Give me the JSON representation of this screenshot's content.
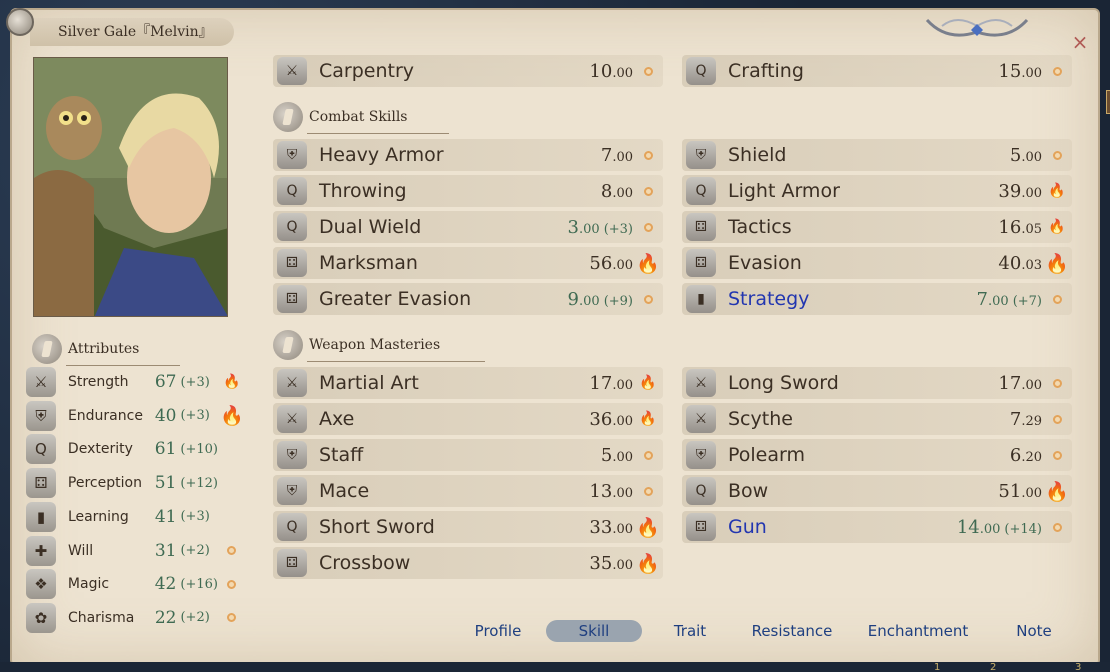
{
  "character": {
    "name": "Silver Gale『Melvin』"
  },
  "window": {
    "close_glyph": "×"
  },
  "attributes": {
    "heading": "Attributes",
    "items": [
      {
        "icon": "crossed-swords-icon",
        "glyph": "⚔",
        "label": "Strength",
        "value": "67",
        "bonus": "(+3)",
        "potential": "flame"
      },
      {
        "icon": "armor-icon",
        "glyph": "⛨",
        "label": "Endurance",
        "value": "40",
        "bonus": "(+3)",
        "potential": "flame-large"
      },
      {
        "icon": "amulet-icon",
        "glyph": "Q",
        "label": "Dexterity",
        "value": "61",
        "bonus": "(+10)",
        "potential": ""
      },
      {
        "icon": "dice-icon",
        "glyph": "⚃",
        "label": "Perception",
        "value": "51",
        "bonus": "(+12)",
        "potential": ""
      },
      {
        "icon": "book-icon",
        "glyph": "▮",
        "label": "Learning",
        "value": "41",
        "bonus": "(+3)",
        "potential": ""
      },
      {
        "icon": "shield-cross-icon",
        "glyph": "✚",
        "label": "Will",
        "value": "31",
        "bonus": "(+2)",
        "potential": "dot"
      },
      {
        "icon": "magic-rune-icon",
        "glyph": "❖",
        "label": "Magic",
        "value": "42",
        "bonus": "(+16)",
        "potential": "dot"
      },
      {
        "icon": "ribbon-icon",
        "glyph": "✿",
        "label": "Charisma",
        "value": "22",
        "bonus": "(+2)",
        "potential": "dot"
      }
    ]
  },
  "skills": {
    "top": [
      {
        "icon": "crossed-swords-icon",
        "glyph": "⚔",
        "label": "Carpentry",
        "value": "10",
        "dec": ".00",
        "bonus": "",
        "potential": "dot",
        "blue": false
      },
      {
        "icon": "amulet-icon",
        "glyph": "Q",
        "label": "Crafting",
        "value": "15",
        "dec": ".00",
        "bonus": "",
        "potential": "dot",
        "blue": false
      }
    ],
    "combat_heading": "Combat Skills",
    "combat": [
      {
        "icon": "armor-icon",
        "glyph": "⛨",
        "label": "Heavy Armor",
        "value": "7",
        "dec": ".00",
        "bonus": "",
        "potential": "dot",
        "blue": false
      },
      {
        "icon": "armor-icon",
        "glyph": "⛨",
        "label": "Shield",
        "value": "5",
        "dec": ".00",
        "bonus": "",
        "potential": "dot",
        "blue": false
      },
      {
        "icon": "amulet-icon",
        "glyph": "Q",
        "label": "Throwing",
        "value": "8",
        "dec": ".00",
        "bonus": "",
        "potential": "dot",
        "blue": false
      },
      {
        "icon": "amulet-icon",
        "glyph": "Q",
        "label": "Light Armor",
        "value": "39",
        "dec": ".00",
        "bonus": "",
        "potential": "flame",
        "blue": false
      },
      {
        "icon": "amulet-icon",
        "glyph": "Q",
        "label": "Dual Wield",
        "value": "3",
        "dec": ".00",
        "bonus": "(+3)",
        "potential": "dot",
        "blue": false
      },
      {
        "icon": "dice-icon",
        "glyph": "⚃",
        "label": "Tactics",
        "value": "16",
        "dec": ".05",
        "bonus": "",
        "potential": "flame",
        "blue": false
      },
      {
        "icon": "dice-icon",
        "glyph": "⚃",
        "label": "Marksman",
        "value": "56",
        "dec": ".00",
        "bonus": "",
        "potential": "flame-plus",
        "blue": false
      },
      {
        "icon": "dice-icon",
        "glyph": "⚃",
        "label": "Evasion",
        "value": "40",
        "dec": ".03",
        "bonus": "",
        "potential": "flame-large",
        "blue": false
      },
      {
        "icon": "dice-icon",
        "glyph": "⚃",
        "label": "Greater Evasion",
        "value": "9",
        "dec": ".00",
        "bonus": "(+9)",
        "potential": "dot",
        "blue": false
      },
      {
        "icon": "book-icon",
        "glyph": "▮",
        "label": "Strategy",
        "value": "7",
        "dec": ".00",
        "bonus": "(+7)",
        "potential": "dot",
        "blue": true
      }
    ],
    "weapon_heading": "Weapon Masteries",
    "weapon": [
      {
        "icon": "crossed-swords-icon",
        "glyph": "⚔",
        "label": "Martial Art",
        "value": "17",
        "dec": ".00",
        "bonus": "",
        "potential": "flame",
        "blue": false
      },
      {
        "icon": "crossed-swords-icon",
        "glyph": "⚔",
        "label": "Long Sword",
        "value": "17",
        "dec": ".00",
        "bonus": "",
        "potential": "dot",
        "blue": false
      },
      {
        "icon": "crossed-swords-icon",
        "glyph": "⚔",
        "label": "Axe",
        "value": "36",
        "dec": ".00",
        "bonus": "",
        "potential": "flame",
        "blue": false
      },
      {
        "icon": "crossed-swords-icon",
        "glyph": "⚔",
        "label": "Scythe",
        "value": "7",
        "dec": ".29",
        "bonus": "",
        "potential": "dot",
        "blue": false
      },
      {
        "icon": "armor-icon",
        "glyph": "⛨",
        "label": "Staff",
        "value": "5",
        "dec": ".00",
        "bonus": "",
        "potential": "dot",
        "blue": false
      },
      {
        "icon": "armor-icon",
        "glyph": "⛨",
        "label": "Polearm",
        "value": "6",
        "dec": ".20",
        "bonus": "",
        "potential": "dot",
        "blue": false
      },
      {
        "icon": "armor-icon",
        "glyph": "⛨",
        "label": "Mace",
        "value": "13",
        "dec": ".00",
        "bonus": "",
        "potential": "dot",
        "blue": false
      },
      {
        "icon": "amulet-icon",
        "glyph": "Q",
        "label": "Bow",
        "value": "51",
        "dec": ".00",
        "bonus": "",
        "potential": "flame-plus",
        "blue": false
      },
      {
        "icon": "amulet-icon",
        "glyph": "Q",
        "label": "Short Sword",
        "value": "33",
        "dec": ".00",
        "bonus": "",
        "potential": "flame-large",
        "blue": false
      },
      {
        "icon": "dice-icon",
        "glyph": "⚃",
        "label": "Gun",
        "value": "14",
        "dec": ".00",
        "bonus": "(+14)",
        "potential": "dot",
        "blue": true
      },
      {
        "icon": "dice-icon",
        "glyph": "⚃",
        "label": "Crossbow",
        "value": "35",
        "dec": ".00",
        "bonus": "",
        "potential": "flame-large",
        "blue": false
      }
    ]
  },
  "tabs": {
    "items": [
      {
        "label": "Profile",
        "active": false
      },
      {
        "label": "Skill",
        "active": true
      },
      {
        "label": "Trait",
        "active": false
      },
      {
        "label": "Resistance",
        "active": false
      },
      {
        "label": "Enchantment",
        "active": false
      },
      {
        "label": "Note",
        "active": false
      }
    ]
  },
  "footer": {
    "left_number": "1",
    "mid_number": "2",
    "right_number": "3"
  },
  "colors": {
    "panel_bg": "#ede3d1",
    "value_green": "#3f6a52",
    "link_blue": "#2236b0",
    "tab_blue": "#1f3f80",
    "flame_orange": "#e58c2f"
  }
}
